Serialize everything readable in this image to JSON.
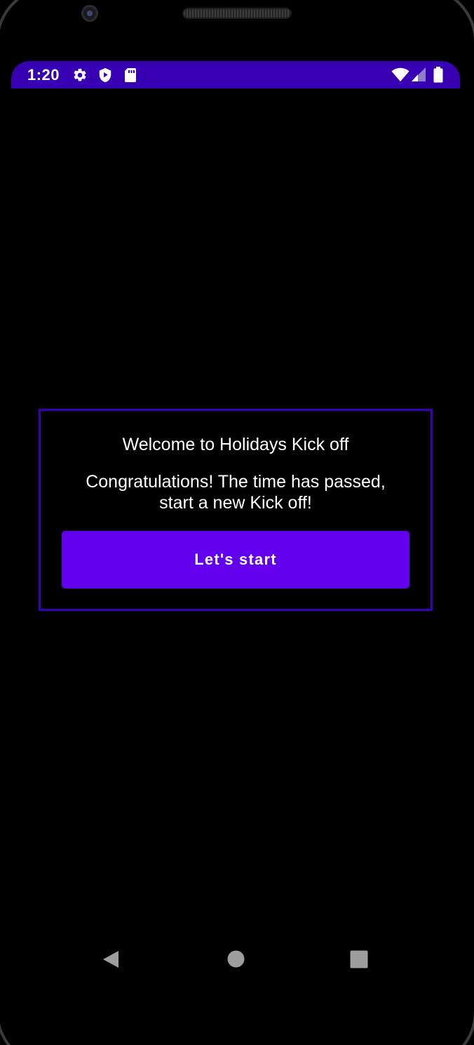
{
  "status_bar": {
    "time": "1:20",
    "background": "#3700b3",
    "left_icons": [
      "settings-icon",
      "shield-play-icon",
      "sd-card-icon"
    ],
    "right_icons": [
      "wifi-icon",
      "cell-signal-icon",
      "battery-icon"
    ]
  },
  "dialog": {
    "title": "Welcome to Holidays Kick off",
    "message": "Congratulations! The time has passed, start a new Kick off!",
    "button_label": "Let's start",
    "border_color": "#3700b3",
    "button_color": "#6200ee"
  },
  "nav_bar": {
    "icons": [
      "back-icon",
      "home-icon",
      "recents-icon"
    ]
  }
}
